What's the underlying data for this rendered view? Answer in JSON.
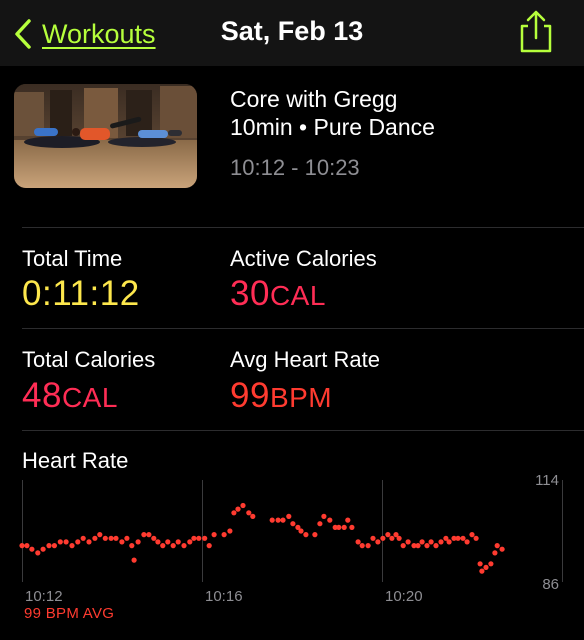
{
  "nav": {
    "back_label": "Workouts",
    "title": "Sat, Feb 13"
  },
  "workout": {
    "name": "Core with Gregg",
    "meta": "10min • Pure Dance",
    "time_range": "10:12 - 10:23"
  },
  "metrics": {
    "total_time": {
      "label": "Total Time",
      "value": "0:11:12"
    },
    "active_calories": {
      "label": "Active Calories",
      "value": "30",
      "unit": "CAL"
    },
    "total_calories": {
      "label": "Total Calories",
      "value": "48",
      "unit": "CAL"
    },
    "avg_heart_rate": {
      "label": "Avg Heart Rate",
      "value": "99",
      "unit": "BPM"
    }
  },
  "heart_rate": {
    "title": "Heart Rate",
    "avg_label": "99 BPM AVG"
  },
  "colors": {
    "accent": "#b6ff3c",
    "time": "#fde74c",
    "calories": "#ff2d55",
    "heart": "#ff3b30"
  },
  "chart_data": {
    "type": "scatter",
    "title": "Heart Rate",
    "x_tick_labels": [
      "10:12",
      "10:16",
      "10:20"
    ],
    "y_tick_labels": [
      "114",
      "86"
    ],
    "ylim": [
      86,
      114
    ],
    "x_unit": "minutes after 10:12",
    "y_unit": "BPM",
    "series": [
      {
        "values": [
          [
            0.0,
            96
          ],
          [
            0.11,
            96
          ],
          [
            0.22,
            95
          ],
          [
            0.35,
            94
          ],
          [
            0.47,
            95
          ],
          [
            0.6,
            96
          ],
          [
            0.72,
            96
          ],
          [
            0.85,
            97
          ],
          [
            0.98,
            97
          ],
          [
            1.11,
            96
          ],
          [
            1.24,
            97
          ],
          [
            1.36,
            98
          ],
          [
            1.49,
            97
          ],
          [
            1.62,
            98
          ],
          [
            1.73,
            99
          ],
          [
            1.85,
            98
          ],
          [
            1.98,
            98
          ],
          [
            2.09,
            98
          ],
          [
            2.22,
            97
          ],
          [
            2.33,
            98
          ],
          [
            2.44,
            96
          ],
          [
            2.49,
            92
          ],
          [
            2.58,
            97
          ],
          [
            2.71,
            99
          ],
          [
            2.82,
            99
          ],
          [
            2.93,
            98
          ],
          [
            3.02,
            97
          ],
          [
            3.13,
            96
          ],
          [
            3.24,
            97
          ],
          [
            3.36,
            96
          ],
          [
            3.47,
            97
          ],
          [
            3.6,
            96
          ],
          [
            3.73,
            97
          ],
          [
            3.82,
            98
          ],
          [
            3.93,
            98
          ],
          [
            4.06,
            98
          ],
          [
            4.16,
            96
          ],
          [
            4.27,
            99
          ],
          [
            4.49,
            99
          ],
          [
            4.62,
            100
          ],
          [
            4.71,
            105
          ],
          [
            4.8,
            106
          ],
          [
            4.91,
            107
          ],
          [
            5.04,
            105
          ],
          [
            5.13,
            104
          ],
          [
            5.56,
            103
          ],
          [
            5.69,
            103
          ],
          [
            5.8,
            103
          ],
          [
            5.93,
            104
          ],
          [
            6.02,
            102
          ],
          [
            6.13,
            101
          ],
          [
            6.2,
            100
          ],
          [
            6.31,
            99
          ],
          [
            6.51,
            99
          ],
          [
            6.62,
            102
          ],
          [
            6.71,
            104
          ],
          [
            6.84,
            103
          ],
          [
            6.96,
            101
          ],
          [
            7.04,
            101
          ],
          [
            7.16,
            101
          ],
          [
            7.24,
            103
          ],
          [
            7.33,
            101
          ],
          [
            7.47,
            97
          ],
          [
            7.56,
            96
          ],
          [
            7.69,
            96
          ],
          [
            7.8,
            98
          ],
          [
            7.91,
            97
          ],
          [
            8.02,
            98
          ],
          [
            8.13,
            99
          ],
          [
            8.22,
            98
          ],
          [
            8.31,
            99
          ],
          [
            8.38,
            98
          ],
          [
            8.47,
            96
          ],
          [
            8.58,
            97
          ],
          [
            8.71,
            96
          ],
          [
            8.8,
            96
          ],
          [
            8.89,
            97
          ],
          [
            9.0,
            96
          ],
          [
            9.09,
            97
          ],
          [
            9.2,
            96
          ],
          [
            9.31,
            97
          ],
          [
            9.42,
            98
          ],
          [
            9.49,
            97
          ],
          [
            9.6,
            98
          ],
          [
            9.69,
            98
          ],
          [
            9.8,
            98
          ],
          [
            9.89,
            97
          ],
          [
            10.0,
            99
          ],
          [
            10.09,
            98
          ],
          [
            10.18,
            91
          ],
          [
            10.22,
            89
          ],
          [
            10.31,
            90
          ],
          [
            10.42,
            91
          ],
          [
            10.51,
            94
          ],
          [
            10.56,
            96
          ],
          [
            10.67,
            95
          ]
        ]
      }
    ]
  }
}
